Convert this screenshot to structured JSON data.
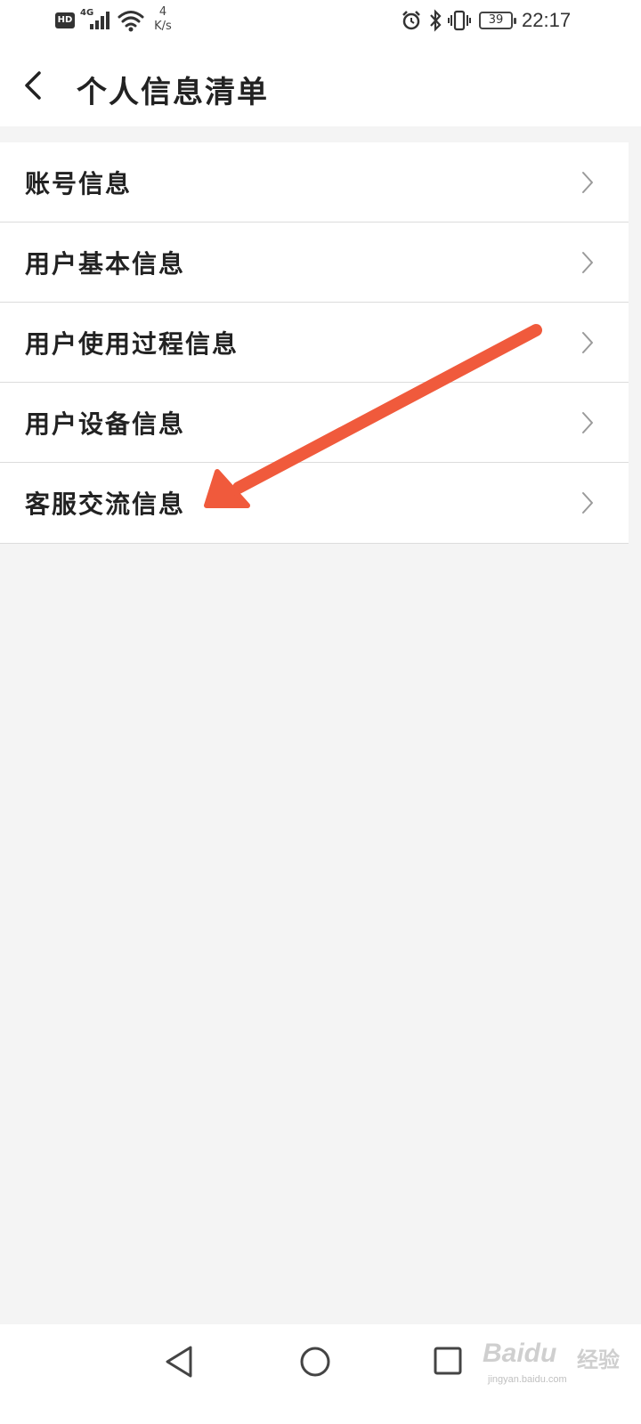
{
  "status_bar": {
    "hd_label": "HD",
    "network_label": "4G",
    "speed_value": "4",
    "speed_unit": "K/s",
    "battery_level": "39",
    "time": "22:17",
    "icons": [
      "hd-icon",
      "signal-icon",
      "wifi-icon",
      "alarm-icon",
      "bluetooth-icon",
      "vibrate-icon",
      "battery-icon"
    ]
  },
  "header": {
    "title": "个人信息清单",
    "back_icon": "chevron-left-icon"
  },
  "menu": {
    "items": [
      {
        "label": "账号信息"
      },
      {
        "label": "用户基本信息"
      },
      {
        "label": "用户使用过程信息"
      },
      {
        "label": "用户设备信息"
      },
      {
        "label": "客服交流信息"
      }
    ],
    "item_icon": "chevron-right-icon"
  },
  "annotation": {
    "arrow_color": "#f05a3c"
  },
  "nav_bar": {
    "icons": [
      "nav-back-icon",
      "nav-home-icon",
      "nav-recent-icon"
    ]
  },
  "watermark": {
    "brand": "Baidu",
    "cn": "经验",
    "url": "jingyan.baidu.com"
  },
  "colors": {
    "background": "#f4f4f4",
    "surface": "#ffffff",
    "divider": "#dcdcdc",
    "text": "#222222",
    "chevron": "#9a9a9a"
  }
}
